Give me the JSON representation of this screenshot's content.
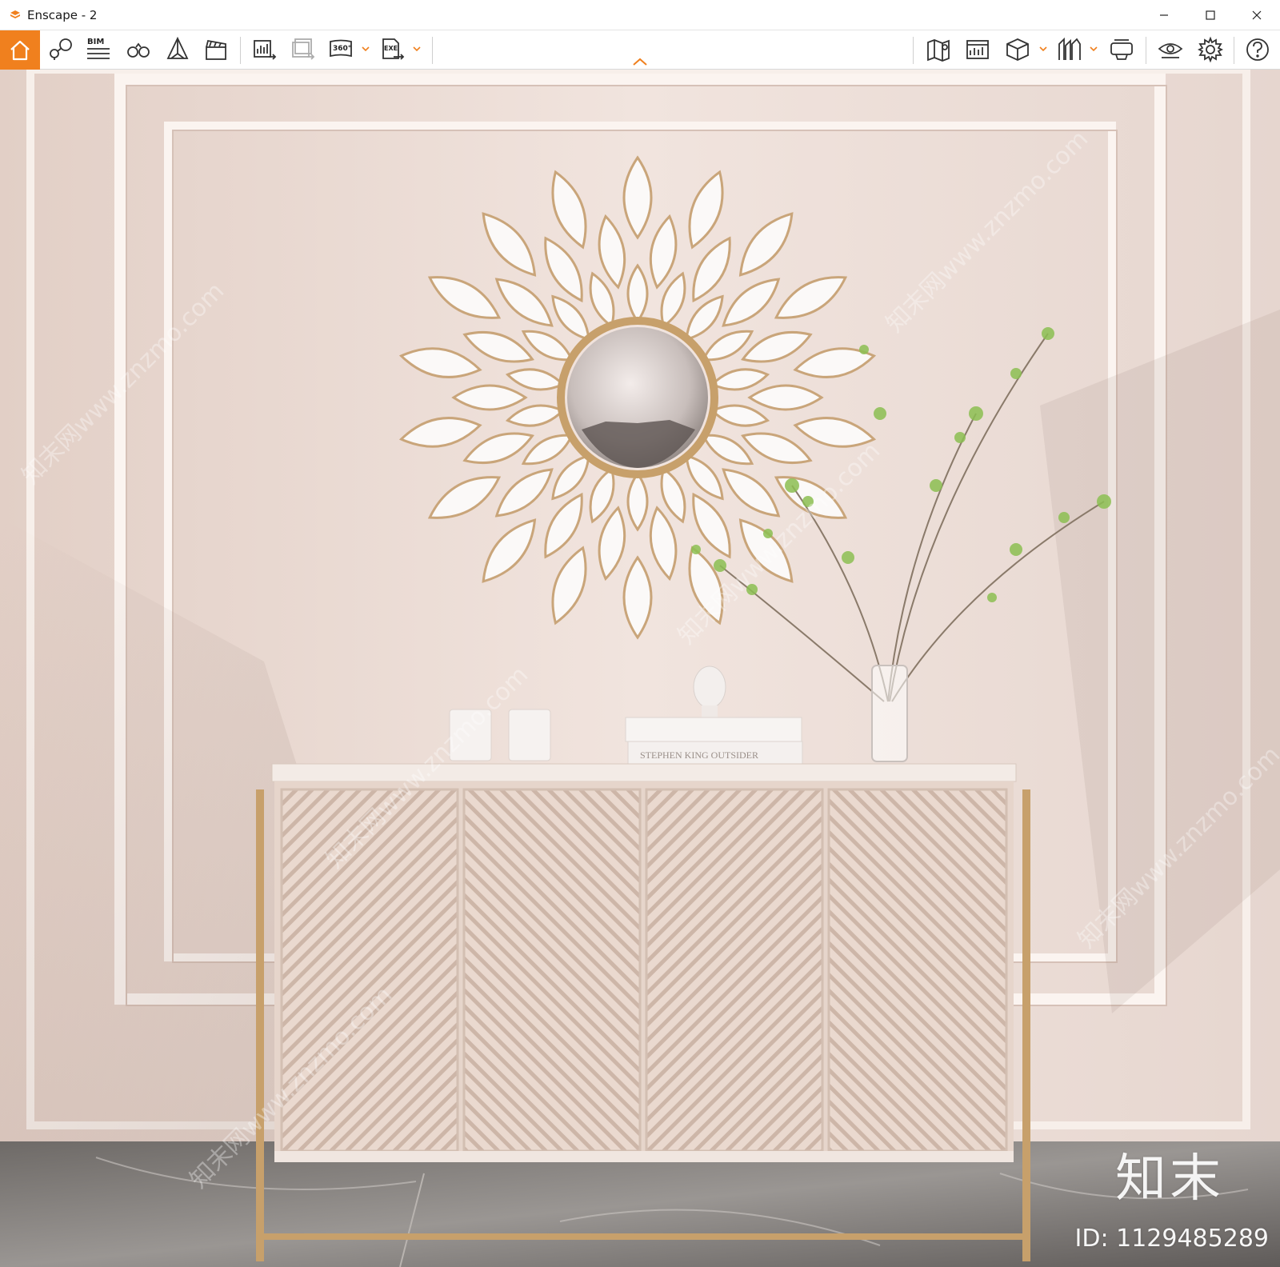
{
  "window": {
    "title": "Enscape - 2",
    "controls": [
      "minimize",
      "maximize",
      "close"
    ]
  },
  "toolbar": {
    "left_icons": [
      "home-icon",
      "pin-path-icon",
      "bim-icon",
      "binoculars-icon",
      "perspective-icon",
      "clapper-icon",
      "render-export-icon",
      "batch-render-icon",
      "panorama-360-icon",
      "exe-export-icon"
    ],
    "bim_label": "BIM",
    "pano_label": "360°",
    "exe_label": "EXE",
    "right_icons": [
      "map-icon",
      "asset-library-icon",
      "cube-icon",
      "views-icon",
      "vr-headset-icon",
      "visual-settings-eye-icon",
      "gear-icon",
      "help-icon"
    ],
    "accent": "#f0801e"
  },
  "viewport": {
    "watermark_logo": "知末",
    "watermark_id": "ID: 1129485289",
    "tiled_watermark": "知末网www.znzmo.com",
    "book_spine": "STEPHEN KING  OUTSIDER",
    "colors": {
      "wall": "#ecddd6",
      "cabinet": "#e6d5cb",
      "brass": "#c7a06b",
      "floor": "#8a8683"
    }
  }
}
